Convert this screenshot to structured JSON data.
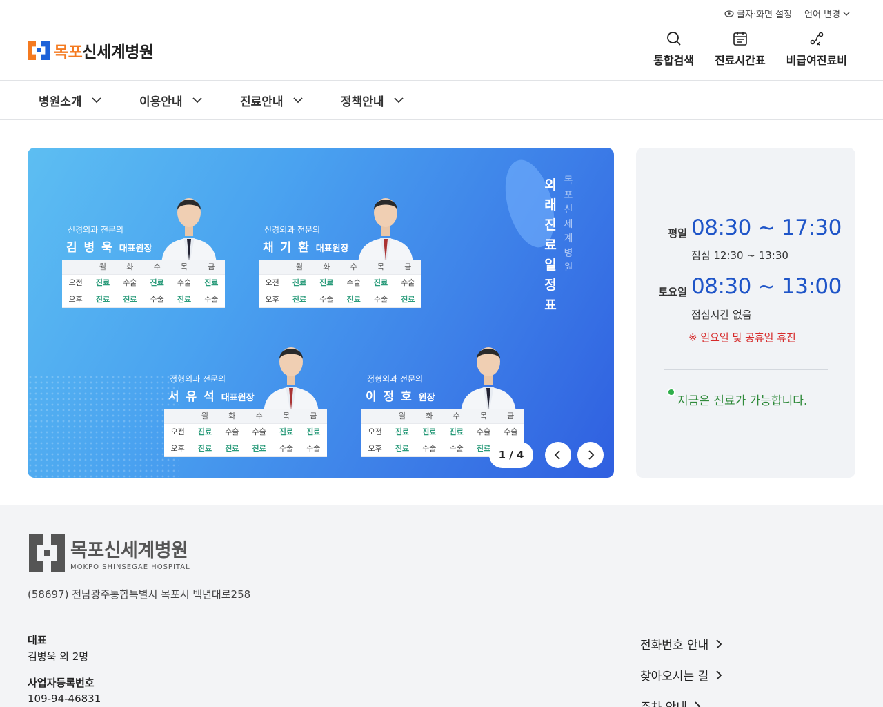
{
  "util": {
    "display_settings": "글자·화면 설정",
    "language": "언어 변경"
  },
  "logo": {
    "orange": "목포",
    "dark": "신세계병원"
  },
  "header_actions": [
    {
      "label": "통합검색",
      "icon": "search-icon"
    },
    {
      "label": "진료시간표",
      "icon": "calendar-icon"
    },
    {
      "label": "비급여진료비",
      "icon": "route-icon"
    }
  ],
  "gnb": [
    "병원소개",
    "이용안내",
    "진료안내",
    "정책안내"
  ],
  "banner": {
    "vertical_title": "외래진료일정표",
    "vertical_sub": "목포신세계병원",
    "pager": "1 / 4",
    "days": [
      "월",
      "화",
      "수",
      "목",
      "금"
    ],
    "am": "오전",
    "pm": "오후",
    "doctors": [
      {
        "specialty": "신경외과 전문의",
        "name": "김병욱",
        "title": "대표원장",
        "am": [
          "진료",
          "수술",
          "진료",
          "수술",
          "진료"
        ],
        "pm": [
          "진료",
          "진료",
          "수술",
          "진료",
          "수술"
        ]
      },
      {
        "specialty": "신경외과 전문의",
        "name": "채기환",
        "title": "대표원장",
        "am": [
          "진료",
          "진료",
          "수술",
          "진료",
          "수술"
        ],
        "pm": [
          "진료",
          "수술",
          "진료",
          "수술",
          "진료"
        ]
      },
      {
        "specialty": "정형외과 전문의",
        "name": "서유석",
        "title": "대표원장",
        "am": [
          "진료",
          "수술",
          "수술",
          "진료",
          "진료"
        ],
        "pm": [
          "진료",
          "진료",
          "진료",
          "수술",
          "수술"
        ]
      },
      {
        "specialty": "정형외과 전문의",
        "name": "이정호",
        "title": "원장",
        "am": [
          "진료",
          "진료",
          "진료",
          "수술",
          "수술"
        ],
        "pm": [
          "진료",
          "수술",
          "수술",
          "진료",
          ""
        ]
      }
    ]
  },
  "hours": {
    "weekday_label": "평일",
    "weekday_time": "08:30 ~ 17:30",
    "weekday_lunch": "점심 12:30 ~ 13:30",
    "saturday_label": "토요일",
    "saturday_time": "08:30 ~ 13:00",
    "saturday_lunch": "점심시간 없음",
    "closed_notice": "※ 일요일 및 공휴일 휴진",
    "status": "지금은 진료가 가능합니다."
  },
  "footer": {
    "logo_kr": "목포신세계병원",
    "logo_en": "MOKPO SHINSEGAE HOSPITAL",
    "address": "(58697) 전남광주통합특별시 목포시 백년대로258",
    "rep_label": "대표",
    "rep_value": "김병욱 외 2명",
    "biz_label": "사업자등록번호",
    "biz_value": "109-94-46831",
    "links": [
      "전화번호 안내",
      "찾아오시는 길",
      "주차 안내"
    ]
  },
  "colors": {
    "accent_blue": "#1f55c8",
    "brand_orange": "#f47a20",
    "status_green": "#2f8a3a",
    "warn_red": "#d62a2a"
  }
}
